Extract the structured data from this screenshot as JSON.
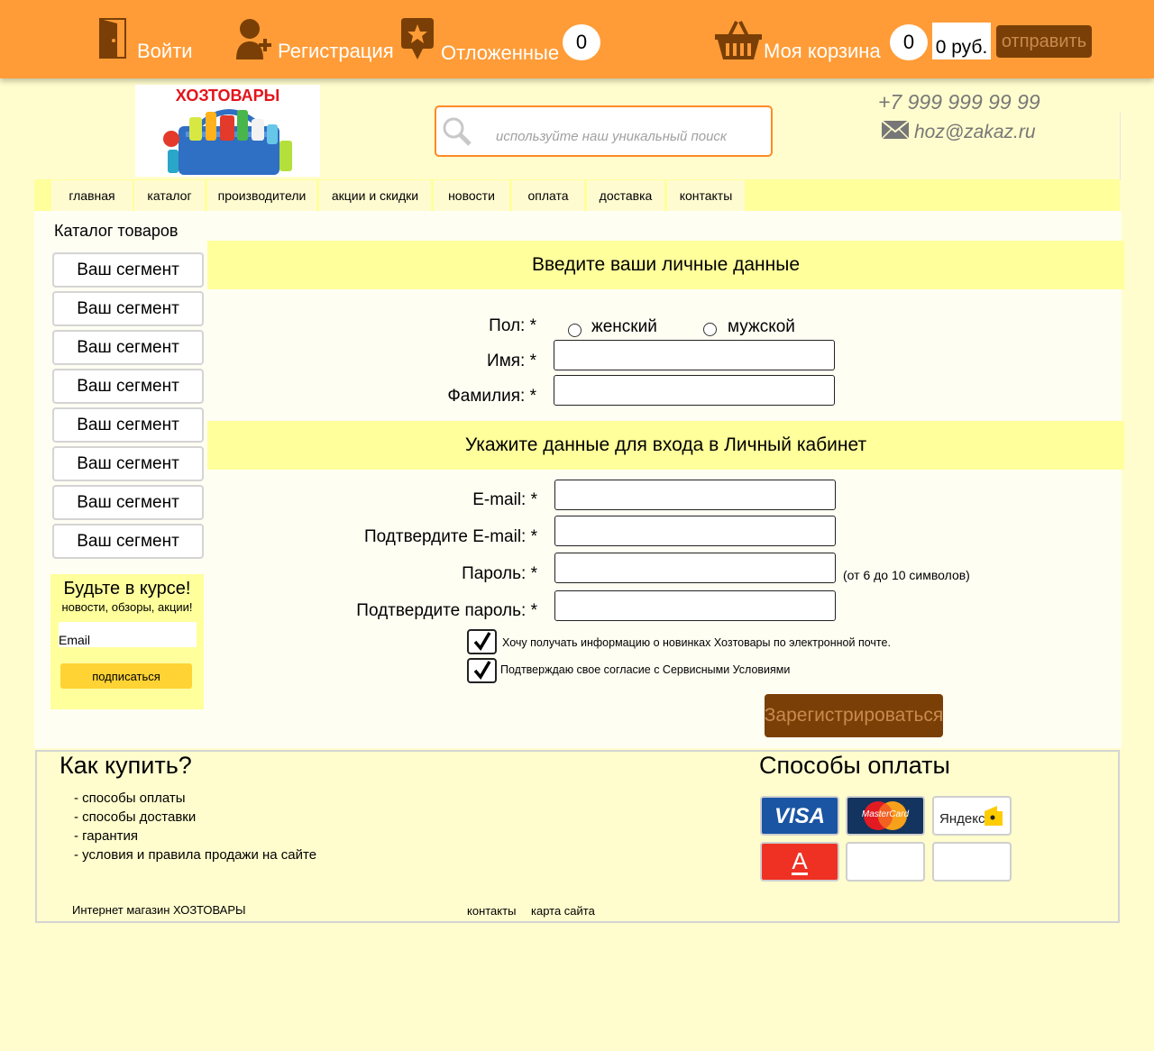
{
  "topbar": {
    "login": "Войти",
    "register": "Регистрация",
    "wishlist": "Отложенные",
    "wishlist_count": "0",
    "cart": "Моя корзина",
    "cart_count": "0",
    "cart_sum": "0 руб.",
    "send": "отправить"
  },
  "header": {
    "logo_text": "ХОЗТОВАРЫ",
    "search_placeholder": "используйте наш уникальный поиск",
    "phone": "+7 999 999 99 99",
    "email": "hoz@zakaz.ru"
  },
  "nav": [
    "главная",
    "каталог",
    "производители",
    "акции и скидки",
    "новости",
    "оплата",
    "доставка",
    "контакты"
  ],
  "sidebar": {
    "title": "Каталог товаров",
    "segments": [
      "Ваш сегмент",
      "Ваш сегмент",
      "Ваш сегмент",
      "Ваш сегмент",
      "Ваш сегмент",
      "Ваш сегмент",
      "Ваш сегмент",
      "Ваш сегмент"
    ],
    "news_title": "Будьте в курсе!",
    "news_sub": "новости, обзоры, акции!",
    "news_email_placeholder": "Email",
    "subscribe": "подписаться"
  },
  "form": {
    "personal_heading": "Введите ваши личные данные",
    "gender_label": "Пол: *",
    "gender_female": "женский",
    "gender_male": "мужской",
    "first_name_label": "Имя: *",
    "last_name_label": "Фамилия: *",
    "login_heading": "Укажите данные для входа в Личный кабинет",
    "email_label": "E-mail: *",
    "email_confirm_label": "Подтвердите E-mail: *",
    "password_label": "Пароль: *",
    "password_hint": "(от 6 до 10 символов)",
    "password_confirm_label": "Подтвердите пароль: *",
    "newsletter_checkbox": "Хочу получать информацию о новинках Хозтовары по электронной почте.",
    "terms_checkbox": "Подтверждаю свое согласие с Сервисными Условиями",
    "submit": "Зарегистрироваться"
  },
  "footer": {
    "how_title": "Как купить?",
    "links": [
      "- способы оплаты",
      "- способы доставки",
      "- гарантия",
      "- условия и правила продажи на сайте"
    ],
    "payments_title": "Способы оплаты",
    "payment_visa": "VISA",
    "payment_mastercard": "MasterCard",
    "payment_yandex": "Яндекс",
    "payment_alfa": "А",
    "shop_name": "Интернет магазин ХОЗТОВАРЫ",
    "contacts": "контакты",
    "sitemap": "карта сайта"
  },
  "colors": {
    "topbar": "#ff9c37",
    "page_bg": "#fffdcd",
    "section_band": "#ffff9c",
    "button_brown": "#7a3f06",
    "subscribe_yellow": "#ffd334",
    "search_border": "#ff8a25"
  }
}
